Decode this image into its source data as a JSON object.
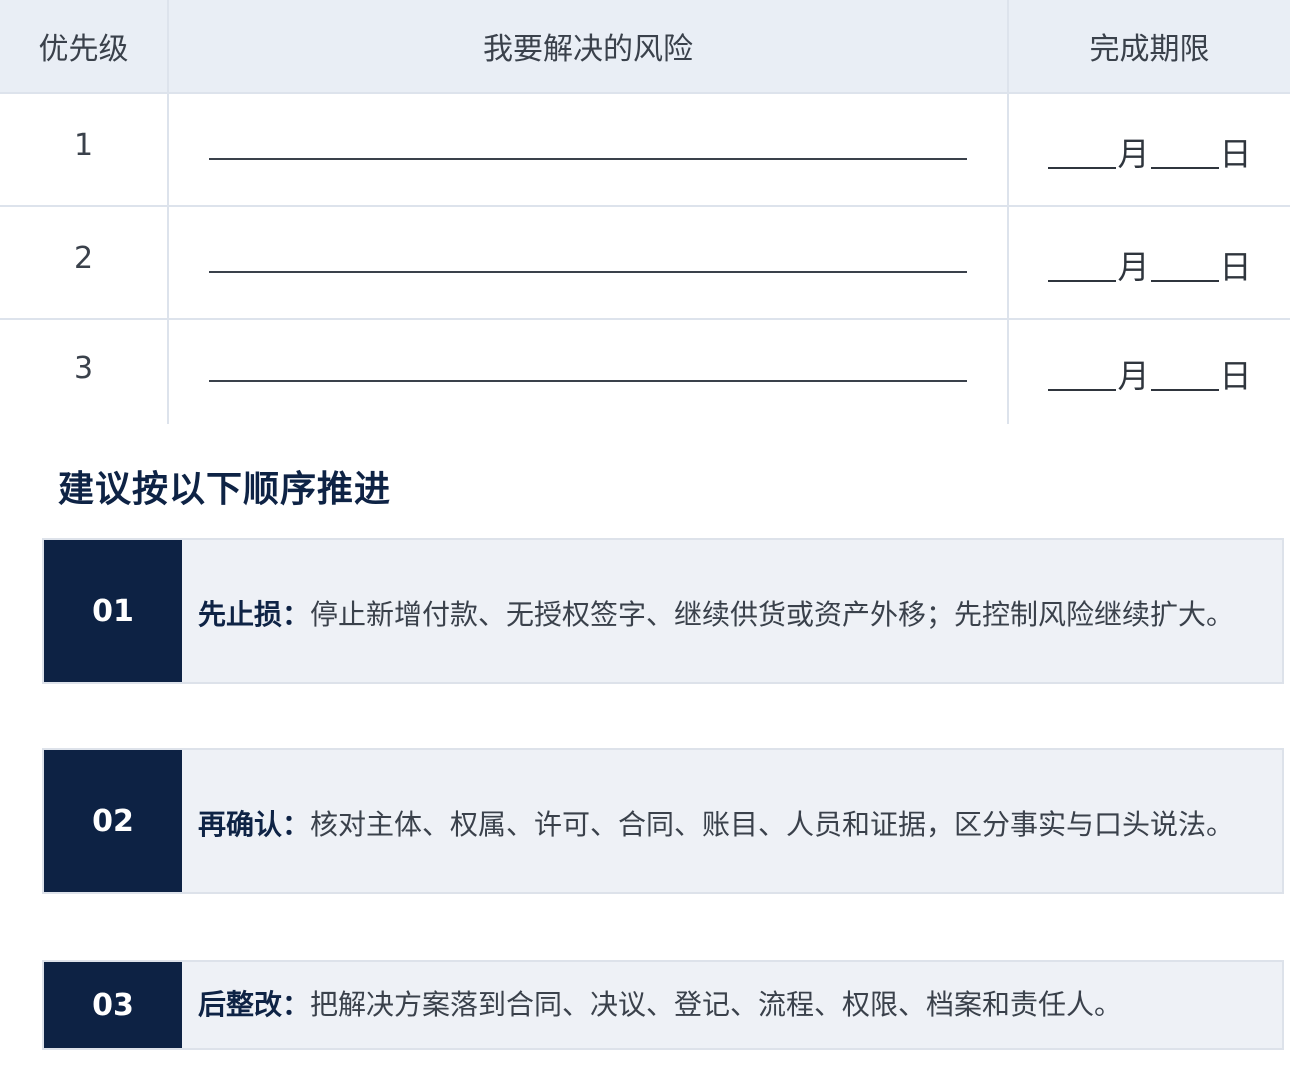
{
  "table": {
    "headers": [
      "优先级",
      "我要解决的风险",
      "完成期限"
    ],
    "rows": [
      {
        "priority": "1",
        "month": "月",
        "day": "日"
      },
      {
        "priority": "2",
        "month": "月",
        "day": "日"
      },
      {
        "priority": "3",
        "month": "月",
        "day": "日"
      }
    ]
  },
  "section": {
    "title": "建议按以下顺序推进"
  },
  "steps": [
    {
      "number": "01",
      "label": "先止损：",
      "text": "停止新增付款、无授权签字、继续供货或资产外移；先控制风险继续扩大。"
    },
    {
      "number": "02",
      "label": "再确认：",
      "text": "核对主体、权属、许可、合同、账目、人员和证据，区分事实与口头说法。"
    },
    {
      "number": "03",
      "label": "后整改：",
      "text": "把解决方案落到合同、决议、登记、流程、权限、档案和责任人。"
    }
  ],
  "colors": {
    "navy": "#0d2244",
    "header_bg": "#e9eef5",
    "step_bg": "#eef1f6",
    "border": "#dde3ec"
  }
}
